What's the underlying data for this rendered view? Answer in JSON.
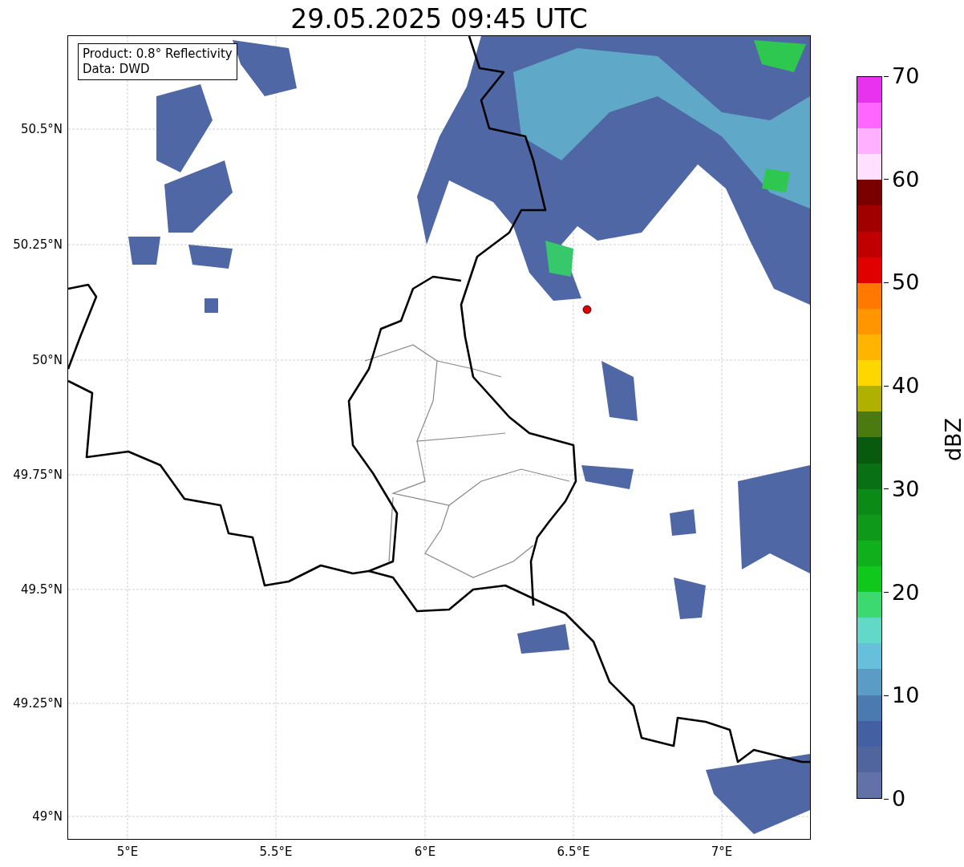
{
  "title": "29.05.2025 09:45 UTC",
  "info_box": {
    "lines": [
      "Product: 0.8° Reflectivity",
      "Data: DWD"
    ]
  },
  "map": {
    "x_ticks": [
      "5°E",
      "5.5°E",
      "6°E",
      "6.5°E",
      "7°E"
    ],
    "y_ticks": [
      "50.5°N",
      "50.25°N",
      "50°N",
      "49.75°N",
      "49.5°N",
      "49.25°N",
      "49°N"
    ]
  },
  "colorbar": {
    "label": "dBZ",
    "ticks": [
      "70",
      "60",
      "50",
      "40",
      "30",
      "20",
      "10",
      "0"
    ],
    "segments": [
      {
        "color": "#6272a8"
      },
      {
        "color": "#50649e"
      },
      {
        "color": "#4260a2"
      },
      {
        "color": "#4a7ab0"
      },
      {
        "color": "#5a9cc6"
      },
      {
        "color": "#66c0dc"
      },
      {
        "color": "#62d8c8"
      },
      {
        "color": "#3cd870"
      },
      {
        "color": "#10c81c"
      },
      {
        "color": "#10b01c"
      },
      {
        "color": "#0e9a18"
      },
      {
        "color": "#0c8a18"
      },
      {
        "color": "#0a7014"
      },
      {
        "color": "#085a0e"
      },
      {
        "color": "#4a7a10"
      },
      {
        "color": "#b0b000"
      },
      {
        "color": "#ffd700"
      },
      {
        "color": "#ffb400"
      },
      {
        "color": "#ff9600"
      },
      {
        "color": "#ff7800"
      },
      {
        "color": "#e00000"
      },
      {
        "color": "#c00000"
      },
      {
        "color": "#a00000"
      },
      {
        "color": "#7a0000"
      },
      {
        "color": "#ffe0ff"
      },
      {
        "color": "#ffb0ff"
      },
      {
        "color": "#ff66ff"
      },
      {
        "color": "#e833ee"
      }
    ]
  }
}
